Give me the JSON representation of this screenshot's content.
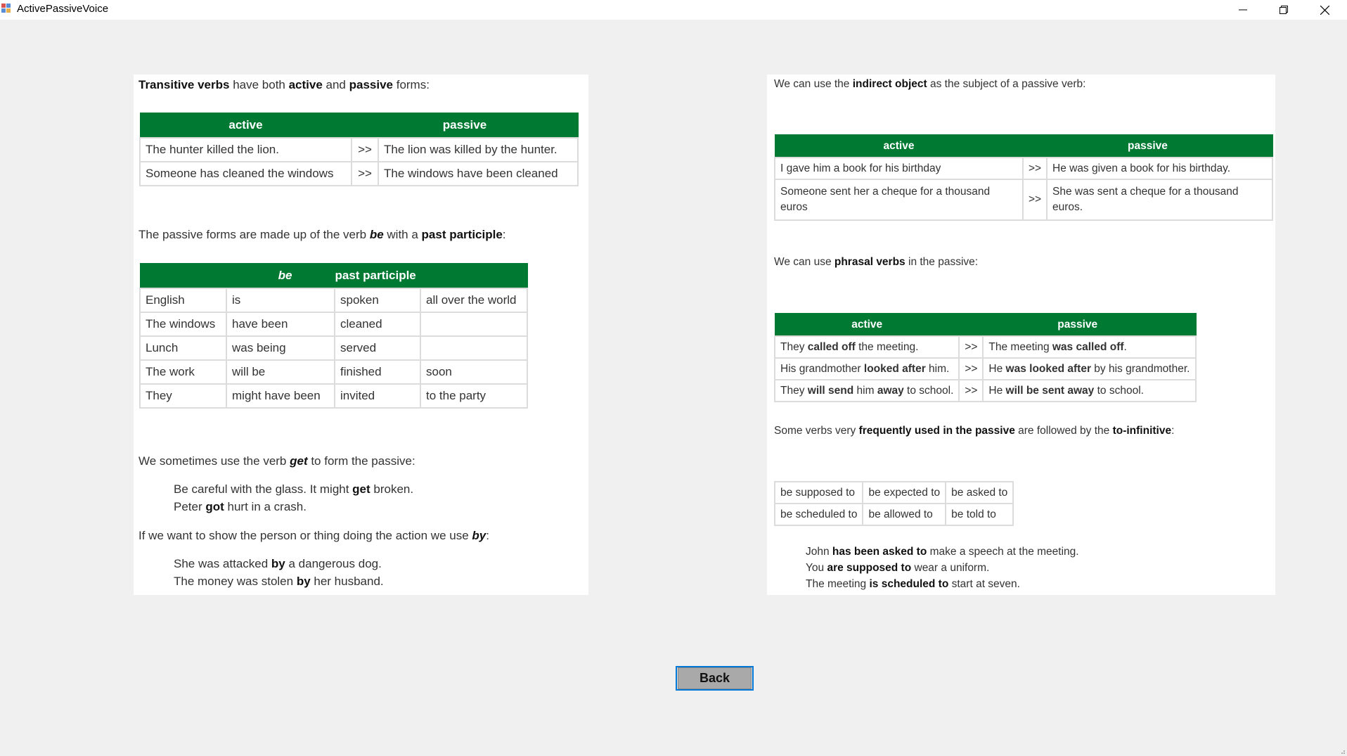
{
  "window": {
    "title": "ActivePassiveVoice",
    "minimize_glyph": "—",
    "restore_glyph": "❐",
    "close_glyph": "✕"
  },
  "left": {
    "intro": {
      "b1": "Transitive verbs",
      "t1": " have both ",
      "b2": "active",
      "t2": " and ",
      "b3": "passive",
      "t3": " forms:"
    },
    "table1": {
      "headers": [
        "active",
        "passive"
      ],
      "rows": [
        [
          "The hunter killed the lion.",
          ">>",
          "The lion was killed by the hunter."
        ],
        [
          "Someone has cleaned the windows",
          ">>",
          "The windows have been cleaned"
        ]
      ]
    },
    "para2": {
      "t1": "The passive forms are made up of the verb ",
      "i1": "be",
      "t2": " with a ",
      "b1": "past participle",
      "t3": ":"
    },
    "table2": {
      "headers": [
        "be",
        "past participle"
      ],
      "rows": [
        [
          "English",
          "is",
          "spoken",
          "all over the world"
        ],
        [
          "The windows",
          "have been",
          "cleaned",
          ""
        ],
        [
          "Lunch",
          "was being",
          "served",
          ""
        ],
        [
          "The work",
          "will be",
          "finished",
          "soon"
        ],
        [
          "They",
          "might have been",
          "invited",
          "to the party"
        ]
      ]
    },
    "para3": {
      "t1": "We sometimes use the verb ",
      "i1": "get",
      "t2": " to form the passive:"
    },
    "ex1": {
      "t1": "Be careful with the glass. It might ",
      "b1": "get",
      "t2": " broken."
    },
    "ex2": {
      "t1": "Peter ",
      "b1": "got",
      "t2": " hurt in a crash."
    },
    "para4": {
      "t1": "If we want to show the person or thing doing the action we use ",
      "i1": "by",
      "t2": ":"
    },
    "ex3": {
      "t1": "She was attacked ",
      "b1": "by",
      "t2": " a dangerous dog."
    },
    "ex4": {
      "t1": "The money was stolen ",
      "b1": "by",
      "t2": " her husband."
    }
  },
  "right": {
    "intro": {
      "t1": "We can use the ",
      "b1": "indirect object",
      "t2": " as the subject of a passive verb:"
    },
    "table1": {
      "headers": [
        "active",
        "passive"
      ],
      "rows": [
        [
          "I gave him a book for his birthday",
          ">>",
          "He was given a book for his birthday."
        ],
        [
          "Someone sent her a cheque for a thousand euros",
          ">>",
          "She was sent a cheque for a thousand euros."
        ]
      ]
    },
    "para2": {
      "t1": "We can use ",
      "b1": "phrasal verbs",
      "t2": " in the passive:"
    },
    "table2": {
      "headers": [
        "active",
        "passive"
      ],
      "rows": [
        {
          "a1": "They ",
          "ab": "called off",
          "a2": " the meeting.",
          "sep": ">>",
          "p1": "The meeting ",
          "pb": "was called off",
          "p2": "."
        },
        {
          "a1": "His grandmother ",
          "ab": "looked after",
          "a2": " him.",
          "sep": ">>",
          "p1": "He ",
          "pb": "was looked after",
          "p2": " by his grandmother."
        },
        {
          "a1": "They ",
          "ab": "will send",
          "a2": " him ",
          "ab2": "away",
          "a3": " to school.",
          "sep": ">>",
          "p1": "He ",
          "pb": "will be sent away",
          "p2": " to school."
        }
      ]
    },
    "para3": {
      "t1": "Some verbs very ",
      "b1": "frequently used in the passive",
      "t2": " are followed by the ",
      "b2": "to-infinitive",
      "t3": ":"
    },
    "table3": {
      "rows": [
        [
          "be supposed to",
          "be expected to",
          "be asked to"
        ],
        [
          "be scheduled to",
          "be allowed to",
          "be told to"
        ]
      ]
    },
    "ex1": {
      "t1": "John ",
      "b1": "has been asked to",
      "t2": " make a speech at the meeting."
    },
    "ex2": {
      "t1": "You ",
      "b1": "are supposed to",
      "t2": " wear a uniform."
    },
    "ex3": {
      "t1": "The meeting ",
      "b1": "is scheduled to",
      "t2": " start at seven."
    }
  },
  "back_button": {
    "label": "Back"
  },
  "colors": {
    "header_green": "#007a33",
    "focus_border": "#0078d7"
  }
}
